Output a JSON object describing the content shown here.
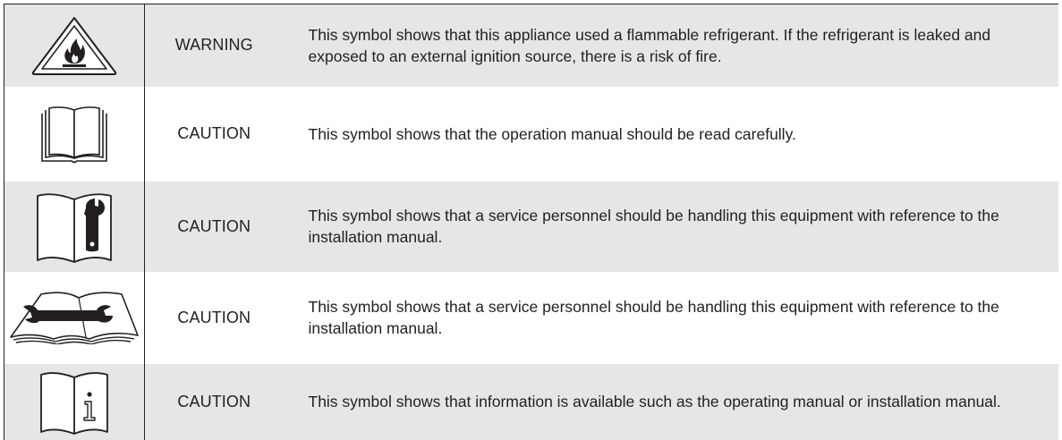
{
  "rows": [
    {
      "icon": "flammable-refrigerant-warning-icon",
      "level": "WARNING",
      "description": "This symbol shows that this appliance used a flammable refrigerant. If the refrigerant is leaked and exposed to an external ignition source, there is a risk of fire."
    },
    {
      "icon": "read-operation-manual-icon",
      "level": "CAUTION",
      "description": "This symbol shows that the operation manual should be read carefully."
    },
    {
      "icon": "service-wrench-manual-icon",
      "level": "CAUTION",
      "description": "This symbol shows that a service personnel should be handling this equipment with reference to the installation manual."
    },
    {
      "icon": "installation-manual-wrench-icon",
      "level": "CAUTION",
      "description": "This symbol shows that a service personnel should be handling this equipment with reference to the installation manual."
    },
    {
      "icon": "information-manual-icon",
      "level": "CAUTION",
      "description": "This symbol shows that information is available such as the operating manual or installation manual."
    }
  ]
}
